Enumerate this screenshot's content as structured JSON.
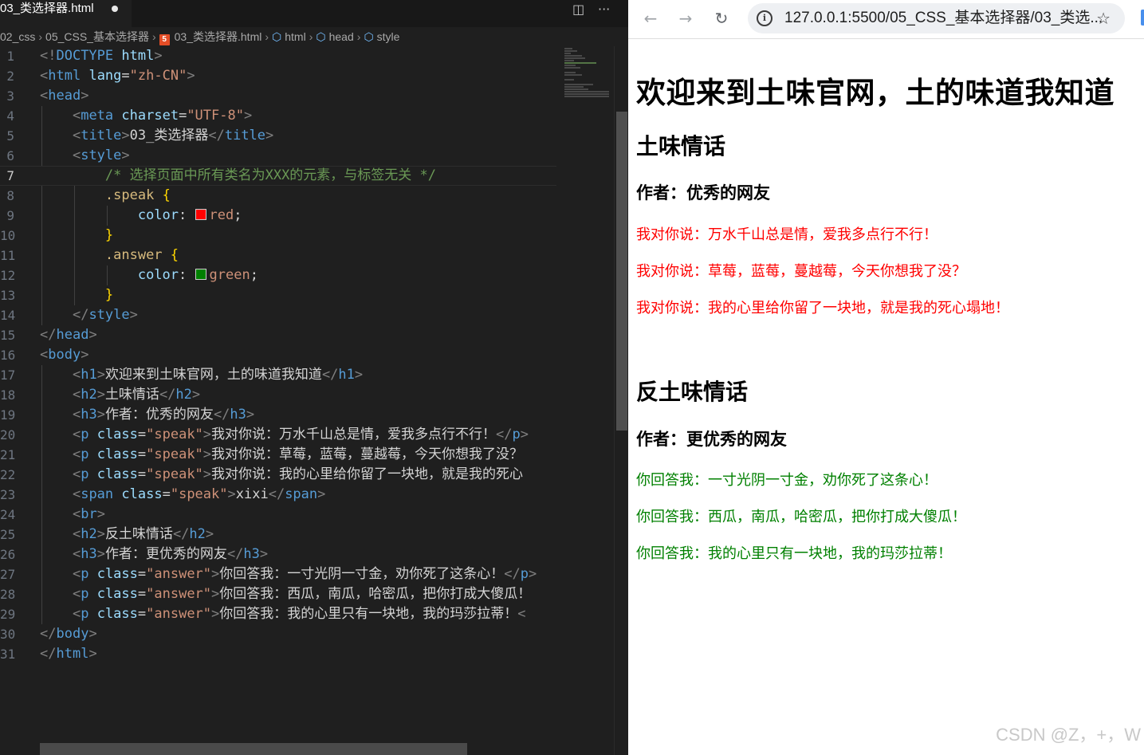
{
  "editor": {
    "tab": {
      "filename": "03_类选择器.html"
    },
    "breadcrumb": [
      "02_css",
      "05_CSS_基本选择器",
      "03_类选择器.html",
      "html",
      "head",
      "style"
    ],
    "lines": [
      {
        "n": "1"
      },
      {
        "n": "2"
      },
      {
        "n": "3"
      },
      {
        "n": "4"
      },
      {
        "n": "5"
      },
      {
        "n": "6"
      },
      {
        "n": "7"
      },
      {
        "n": "8"
      },
      {
        "n": "9"
      },
      {
        "n": "10"
      },
      {
        "n": "11"
      },
      {
        "n": "12"
      },
      {
        "n": "13"
      },
      {
        "n": "14"
      },
      {
        "n": "15"
      },
      {
        "n": "16"
      },
      {
        "n": "17"
      },
      {
        "n": "18"
      },
      {
        "n": "19"
      },
      {
        "n": "20"
      },
      {
        "n": "21"
      },
      {
        "n": "22"
      },
      {
        "n": "23"
      },
      {
        "n": "24"
      },
      {
        "n": "25"
      },
      {
        "n": "26"
      },
      {
        "n": "27"
      },
      {
        "n": "28"
      },
      {
        "n": "29"
      },
      {
        "n": "30"
      },
      {
        "n": "31"
      }
    ],
    "code": {
      "doctype": "DOCTYPE",
      "html_kw": "html",
      "lang_attr": "lang",
      "lang_val": "\"zh-CN\"",
      "head": "head",
      "meta": "meta",
      "charset_attr": "charset",
      "charset_val": "\"UTF-8\"",
      "title": "title",
      "title_text": "03_类选择器",
      "style": "style",
      "comment": "/* 选择页面中所有类名为XXX的元素，与标签无关 */",
      "sel_speak": ".speak",
      "sel_answer": ".answer",
      "color_prop": "color",
      "val_red": "red",
      "val_green": "green",
      "body": "body",
      "h1": "h1",
      "h1_text": "欢迎来到土味官网，土的味道我知道",
      "h2": "h2",
      "h2_text": "土味情话",
      "h3": "h3",
      "h3_text": "作者：优秀的网友",
      "p": "p",
      "class_attr": "class",
      "speak_val": "\"speak\"",
      "p1_text": "我对你说：万水千山总是情，爱我多点行不行！",
      "p2_text": "我对你说：草莓，蓝莓，蔓越莓，今天你想我了没？",
      "p3_text": "我对你说：我的心里给你留了一块地，就是我的死心",
      "span": "span",
      "span_text": "xixi",
      "br": "br",
      "h2b_text": "反土味情话",
      "h3b_text": "作者：更优秀的网友",
      "answer_val": "\"answer\"",
      "a1_text": "你回答我：一寸光阴一寸金，劝你死了这条心！",
      "a2_text": "你回答我：西瓜，南瓜，哈密瓜，把你打成大傻瓜！",
      "a3_text": "你回答我：我的心里只有一块地，我的玛莎拉蒂！"
    }
  },
  "browser": {
    "url": "127.0.0.1:5500/05_CSS_基本选择器/03_类选...",
    "icons": [
      "back-icon",
      "forward-icon",
      "reload-icon",
      "site-info-icon",
      "bookmark-star-icon"
    ],
    "page": {
      "h1": "欢迎来到土味官网，土的味道我知道",
      "h2": "土味情话",
      "h3": "作者：优秀的网友",
      "speak": [
        "我对你说：万水千山总是情，爱我多点行不行！",
        "我对你说：草莓，蓝莓，蔓越莓，今天你想我了没？",
        "我对你说：我的心里给你留了一块地，就是我的死心塌地！"
      ],
      "h2b": "反土味情话",
      "h3b": "作者：更优秀的网友",
      "answer": [
        "你回答我：一寸光阴一寸金，劝你死了这条心！",
        "你回答我：西瓜，南瓜，哈密瓜，把你打成大傻瓜！",
        "你回答我：我的心里只有一块地，我的玛莎拉蒂！"
      ]
    },
    "watermark": "CSDN @Z，+，W"
  },
  "colors": {
    "speak": "#ff0000",
    "answer": "#008000",
    "editor_bg": "#1f1f1f",
    "tag": "#569cd6",
    "string": "#ce9178",
    "comment": "#6a9955"
  }
}
